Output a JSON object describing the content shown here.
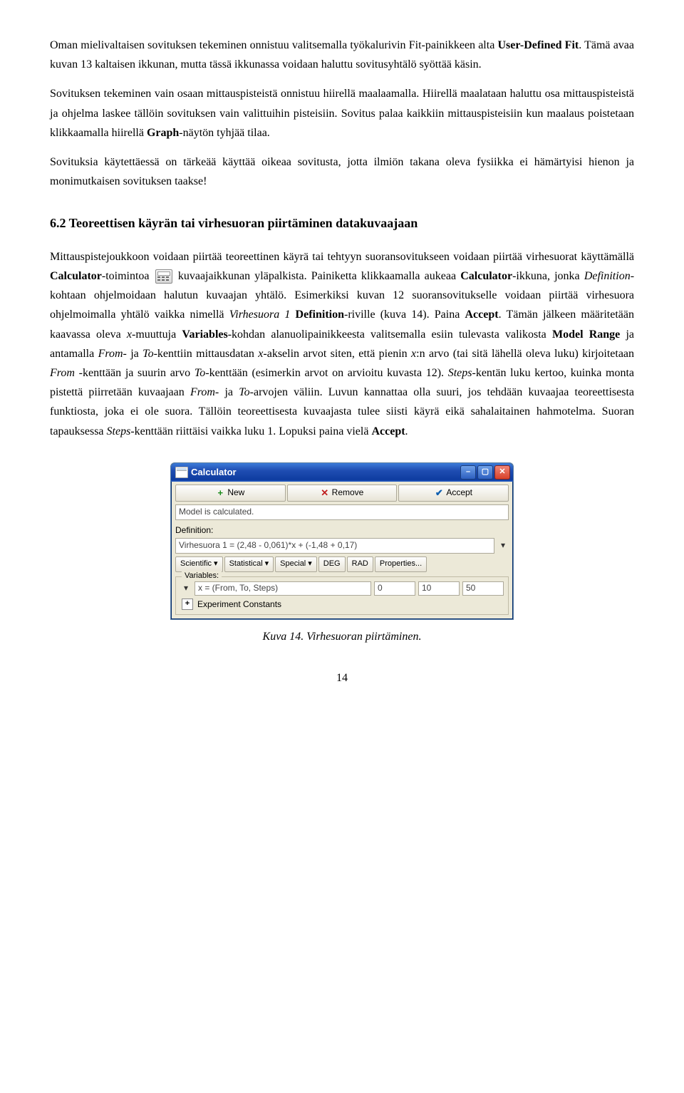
{
  "para1_a": "Oman mielivaltaisen sovituksen tekeminen onnistuu valitsemalla työkalurivin Fit-painikkeen alta ",
  "para1_b": "User-Defined Fit",
  "para1_c": ". Tämä avaa kuvan 13 kaltaisen ikkunan, mutta tässä ikkunassa voidaan haluttu sovitusyhtälö syöttää käsin.",
  "para2_a": "Sovituksen tekeminen vain osaan mittauspisteistä onnistuu hiirellä maalaamalla. Hiirellä maalataan haluttu osa mittauspisteistä ja ohjelma laskee tällöin sovituksen vain valittuihin pisteisiin. Sovitus palaa kaikkiin mittauspisteisiin kun maalaus poistetaan klikkaamalla hiirellä ",
  "para2_b": "Graph",
  "para2_c": "-näytön tyhjää tilaa.",
  "para3": "Sovituksia käytettäessä on tärkeää käyttää oikeaa sovitusta, jotta ilmiön takana oleva fysiikka ei hämärtyisi hienon ja monimutkaisen sovituksen taakse!",
  "heading": "6.2    Teoreettisen käyrän tai virhesuoran piirtäminen datakuvaajaan",
  "p4_1": "Mittauspistejoukkoon voidaan piirtää teoreettinen käyrä tai tehtyyn suoransovitukseen voidaan piirtää virhesuorat käyttämällä ",
  "p4_2": "Calculator",
  "p4_3": "-toimintoa",
  "p4_4": " kuvaajaikkunan yläpalkista. Painiketta klikkaamalla aukeaa ",
  "p4_5": "Calculator",
  "p4_6": "-ikkuna, jonka ",
  "p4_7": "Definition",
  "p4_8": "-kohtaan ohjelmoidaan halutun kuvaajan yhtälö. Esimerkiksi kuvan 12 suoransovitukselle voidaan piirtää virhesuora ohjelmoimalla yhtälö vaikka nimellä ",
  "p4_9": "Virhesuora 1",
  "p4_10": " ",
  "p4_11": "Definition",
  "p4_12": "-riville (kuva 14). Paina ",
  "p4_13": "Accept",
  "p4_14": ". Tämän jälkeen määritetään kaavassa oleva ",
  "p4_15": "x",
  "p4_16": "-muuttuja ",
  "p4_17": "Variables",
  "p4_18": "-kohdan alanuolipainikkeesta valitsemalla esiin tulevasta valikosta ",
  "p4_19": "Model Range",
  "p4_20": " ja antamalla ",
  "p4_21": "From",
  "p4_22": "- ja ",
  "p4_23": "To",
  "p4_24": "-kenttiin mittausdatan ",
  "p4_25": "x",
  "p4_26": "-akselin arvot siten, että pienin ",
  "p4_27": "x",
  "p4_28": ":n arvo (tai sitä lähellä oleva luku) kirjoitetaan ",
  "p4_29": "From",
  "p4_30": " -kenttään ja suurin arvo ",
  "p4_31": "To",
  "p4_32": "-kenttään (esimerkin arvot on arvioitu kuvasta 12). ",
  "p4_33": "Steps",
  "p4_34": "-kentän luku kertoo, kuinka monta pistettä piirretään kuvaajaan ",
  "p4_35": "From",
  "p4_36": "- ja ",
  "p4_37": "To",
  "p4_38": "-arvojen väliin. Luvun kannattaa olla suuri, jos tehdään kuvaajaa teoreettisesta funktiosta, joka ei ole suora. Tällöin teoreettisesta kuvaajasta tulee siisti käyrä eikä sahalaitainen hahmotelma. Suoran tapauksessa ",
  "p4_39": "Steps",
  "p4_40": "-kenttään riittäisi vaikka luku 1. Lopuksi paina vielä ",
  "p4_41": "Accept",
  "p4_42": ".",
  "win": {
    "title": "Calculator",
    "new": "New",
    "remove": "Remove",
    "accept": "Accept",
    "status": "Model is calculated.",
    "def_label": "Definition:",
    "def_value": "Virhesuora 1 = (2,48 - 0,061)*x + (-1,48 + 0,17)",
    "scientific": "Scientific",
    "statistical": "Statistical",
    "special": "Special",
    "deg": "DEG",
    "rad": "RAD",
    "properties": "Properties...",
    "variables": "Variables:",
    "var_expr": "x = (From, To, Steps)",
    "from": "0",
    "to": "10",
    "steps": "50",
    "exp_const": "Experiment Constants"
  },
  "caption": "Kuva 14. Virhesuoran piirtäminen.",
  "page": "14"
}
